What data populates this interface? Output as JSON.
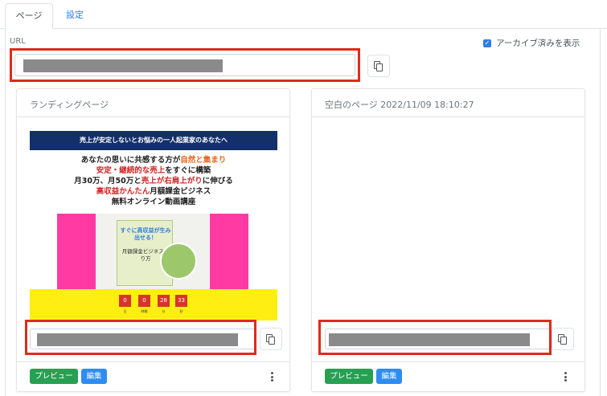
{
  "tabs": [
    {
      "label": "ページ",
      "active": true
    },
    {
      "label": "設定",
      "active": false
    }
  ],
  "url_section": {
    "label": "URL",
    "value_masked": true,
    "archive_toggle": {
      "label": "アーカイブ済みを表示",
      "checked": true
    }
  },
  "cards": [
    {
      "title": "ランディングページ",
      "thumbnail": {
        "banner": "売上が安定しないとお悩みの一人起業家のあなたへ",
        "line1_a": "あなたの思いに共感する方が",
        "line1_b": "自然と集まり",
        "line2_a": "安定・継続的な売上",
        "line2_b": "をすぐに構築",
        "line3_a": "月30万、月50万と",
        "line3_b": "売上が右肩上がり",
        "line3_c": "に伸びる",
        "line4_a": "高収益かんたん",
        "line4_b": "月額課金ビジネス",
        "line5": "無料オンライン動画講座",
        "product_title": "すぐに高収益が生み出せる！",
        "product_sub": "月額課金ビジネス作り方",
        "countdown": [
          "0",
          "0",
          "28",
          "33"
        ],
        "countdown_units": [
          "日",
          "時間",
          "分",
          "秒"
        ]
      },
      "url_masked": true,
      "buttons": {
        "preview": "プレビュー",
        "edit": "編集"
      }
    },
    {
      "title": "空白のページ 2022/11/09 18:10:27",
      "url_masked": true,
      "buttons": {
        "preview": "プレビュー",
        "edit": "編集"
      }
    }
  ],
  "colors": {
    "accent": "#2f7de1",
    "highlight_box": "#e02a1b",
    "preview_button": "#27a052",
    "edit_button": "#2f8cf0",
    "mask": "#8a8a8a"
  },
  "icons": [
    "copy-icon",
    "kebab-menu-icon",
    "checkbox-checked-icon"
  ]
}
